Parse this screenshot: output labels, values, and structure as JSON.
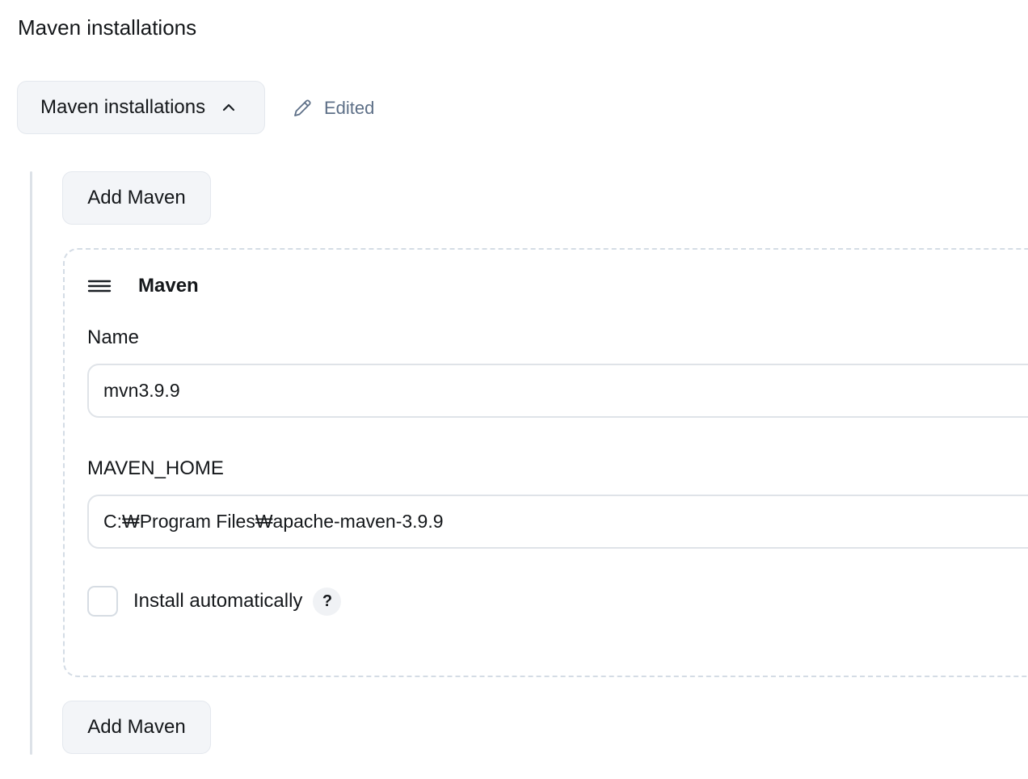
{
  "section": {
    "title": "Maven installations"
  },
  "toggle": {
    "label": "Maven installations",
    "icon": "chevron-up-icon"
  },
  "status": {
    "label": "Edited",
    "icon": "pencil-icon",
    "color": "#5d6f87"
  },
  "add_button_top": {
    "label": "Add Maven"
  },
  "add_button_bottom": {
    "label": "Add Maven"
  },
  "installation": {
    "title": "Maven",
    "drag_icon": "drag-handle-icon",
    "name_label": "Name",
    "name_value": "mvn3.9.9",
    "home_label": "MAVEN_HOME",
    "home_value": "C:₩Program Files₩apache-maven-3.9.9",
    "install_auto_label": "Install automatically",
    "install_auto_checked": false,
    "help_label": "?"
  }
}
